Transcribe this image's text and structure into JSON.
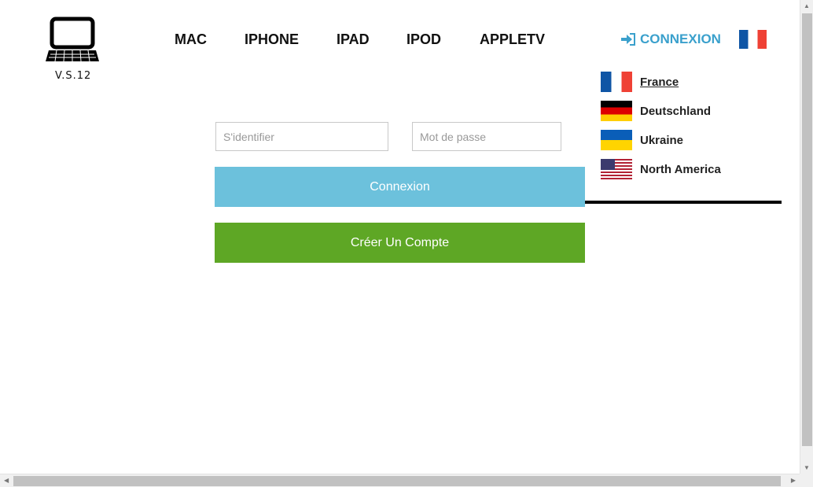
{
  "brand": {
    "logo_icon": "laptop-icon",
    "name": "V.S.12"
  },
  "nav": [
    {
      "label": "MAC"
    },
    {
      "label": "IPHONE"
    },
    {
      "label": "IPAD"
    },
    {
      "label": "IPOD"
    },
    {
      "label": "APPLETV"
    }
  ],
  "header": {
    "login_label": "CONNEXION",
    "login_icon": "sign-in-icon",
    "current_flag": "france-flag-icon"
  },
  "languages": [
    {
      "label": "France",
      "flag": "fr",
      "active": true
    },
    {
      "label": "Deutschland",
      "flag": "de"
    },
    {
      "label": "Ukraine",
      "flag": "ua"
    },
    {
      "label": "North America",
      "flag": "us"
    }
  ],
  "login_form": {
    "username_placeholder": "S'identifier",
    "username_value": "",
    "password_placeholder": "Mot de passe",
    "password_value": "",
    "submit_label": "Connexion",
    "create_account_label": "Créer Un Compte"
  },
  "colors": {
    "accent": "#3aa0cc",
    "login_button": "#6cc1dc",
    "create_button": "#5ea725"
  }
}
